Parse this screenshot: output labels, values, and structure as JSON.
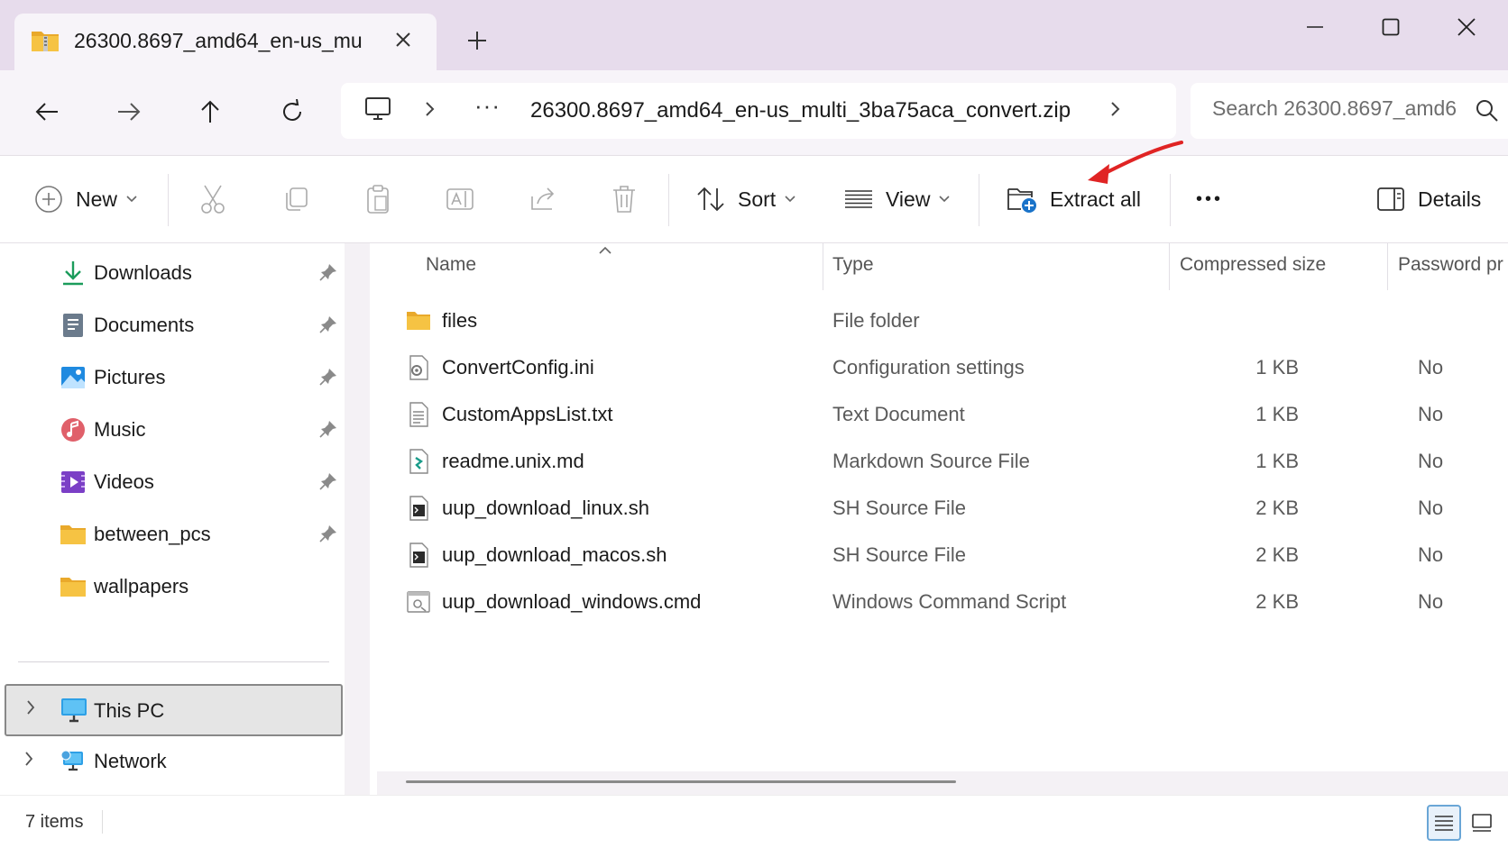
{
  "window": {
    "tab_title": "26300.8697_amd64_en-us_mu",
    "tab_icon": "zip-folder-icon",
    "new_tab_label": "+"
  },
  "address": {
    "location_icon": "this-pc-icon",
    "overflow": "···",
    "path": "26300.8697_amd64_en-us_multi_3ba75aca_convert.zip"
  },
  "search": {
    "placeholder": "Search 26300.8697_amd6"
  },
  "toolbar": {
    "new_label": "New",
    "sort_label": "Sort",
    "view_label": "View",
    "extract_label": "Extract all",
    "more_label": "•••",
    "details_label": "Details"
  },
  "sidebar": {
    "quick_access": [
      {
        "label": "Downloads",
        "icon": "downloads-icon",
        "pinned": true
      },
      {
        "label": "Documents",
        "icon": "documents-icon",
        "pinned": true
      },
      {
        "label": "Pictures",
        "icon": "pictures-icon",
        "pinned": true
      },
      {
        "label": "Music",
        "icon": "music-icon",
        "pinned": true
      },
      {
        "label": "Videos",
        "icon": "videos-icon",
        "pinned": true
      },
      {
        "label": "between_pcs",
        "icon": "folder-icon",
        "pinned": true
      },
      {
        "label": "wallpapers",
        "icon": "folder-icon",
        "pinned": false
      }
    ],
    "this_pc_label": "This PC",
    "network_label": "Network"
  },
  "columns": {
    "name": "Name",
    "type": "Type",
    "compressed_size": "Compressed size",
    "password": "Password pr"
  },
  "files": [
    {
      "name": "files",
      "type": "File folder",
      "size": "",
      "password": "",
      "icon": "folder-icon"
    },
    {
      "name": "ConvertConfig.ini",
      "type": "Configuration settings",
      "size": "1 KB",
      "password": "No",
      "icon": "config-file-icon"
    },
    {
      "name": "CustomAppsList.txt",
      "type": "Text Document",
      "size": "1 KB",
      "password": "No",
      "icon": "text-file-icon"
    },
    {
      "name": "readme.unix.md",
      "type": "Markdown Source File",
      "size": "1 KB",
      "password": "No",
      "icon": "markdown-file-icon"
    },
    {
      "name": "uup_download_linux.sh",
      "type": "SH Source File",
      "size": "2 KB",
      "password": "No",
      "icon": "shell-script-icon"
    },
    {
      "name": "uup_download_macos.sh",
      "type": "SH Source File",
      "size": "2 KB",
      "password": "No",
      "icon": "shell-script-icon"
    },
    {
      "name": "uup_download_windows.cmd",
      "type": "Windows Command Script",
      "size": "2 KB",
      "password": "No",
      "icon": "cmd-script-icon"
    }
  ],
  "status": {
    "item_count": "7 items"
  },
  "colors": {
    "titlebar": "#e7dcec",
    "navrow": "#f7f4f9",
    "folder_yellow": "#f6c343",
    "annotation_red": "#e02424",
    "selection": "#e5e5e5"
  }
}
